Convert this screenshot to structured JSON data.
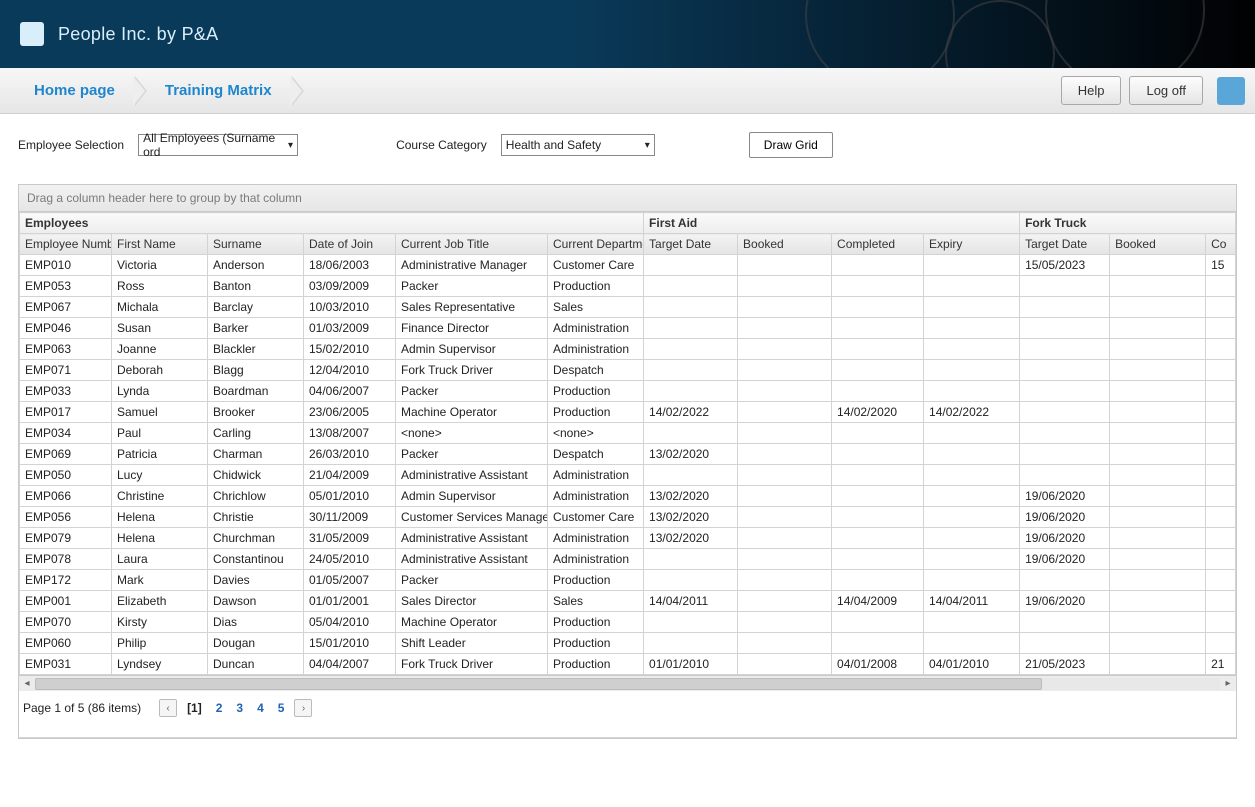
{
  "header": {
    "title": "People Inc. by P&A"
  },
  "breadcrumb": {
    "home": "Home page",
    "current": "Training Matrix"
  },
  "toolbar": {
    "help": "Help",
    "logoff": "Log off"
  },
  "filters": {
    "emp_label": "Employee Selection",
    "emp_value": "All Employees (Surname ord",
    "course_label": "Course Category",
    "course_value": "Health and Safety",
    "draw": "Draw Grid"
  },
  "grid": {
    "group_hint": "Drag a column header here to group by that column",
    "groups": {
      "emp": "Employees",
      "fa": "First Aid",
      "ft": "Fork Truck"
    },
    "cols": {
      "emp_no": "Employee Number",
      "first": "First Name",
      "surname": "Surname",
      "doj": "Date of Join",
      "title": "Current Job Title",
      "dept": "Current Departmen",
      "fa_target": "Target Date",
      "fa_booked": "Booked",
      "fa_comp": "Completed",
      "fa_exp": "Expiry",
      "ft_target": "Target Date",
      "ft_booked": "Booked",
      "ft_co": "Co"
    },
    "rows": [
      {
        "no": "EMP010",
        "first": "Victoria",
        "sur": "Anderson",
        "doj": "18/06/2003",
        "title": "Administrative Manager",
        "dept": "Customer Care",
        "fa_t": "",
        "fa_b": "",
        "fa_c": "",
        "fa_e": "",
        "ft_t": "15/05/2023",
        "ft_b": "",
        "ft_co": "15"
      },
      {
        "no": "EMP053",
        "first": "Ross",
        "sur": "Banton",
        "doj": "03/09/2009",
        "title": "Packer",
        "dept": "Production",
        "fa_t": "",
        "fa_b": "",
        "fa_c": "",
        "fa_e": "",
        "ft_t": "",
        "ft_b": "",
        "ft_co": ""
      },
      {
        "no": "EMP067",
        "first": "Michala",
        "sur": "Barclay",
        "doj": "10/03/2010",
        "title": "Sales Representative",
        "dept": "Sales",
        "fa_t": "",
        "fa_b": "",
        "fa_c": "",
        "fa_e": "",
        "ft_t": "",
        "ft_b": "",
        "ft_co": ""
      },
      {
        "no": "EMP046",
        "first": "Susan",
        "sur": "Barker",
        "doj": "01/03/2009",
        "title": "Finance Director",
        "dept": "Administration",
        "fa_t": "",
        "fa_b": "",
        "fa_c": "",
        "fa_e": "",
        "ft_t": "",
        "ft_b": "",
        "ft_co": ""
      },
      {
        "no": "EMP063",
        "first": "Joanne",
        "sur": "Blackler",
        "doj": "15/02/2010",
        "title": "Admin Supervisor",
        "dept": "Administration",
        "fa_t": "",
        "fa_b": "",
        "fa_c": "",
        "fa_e": "",
        "ft_t": "",
        "ft_b": "",
        "ft_co": ""
      },
      {
        "no": "EMP071",
        "first": "Deborah",
        "sur": "Blagg",
        "doj": "12/04/2010",
        "title": "Fork Truck Driver",
        "dept": "Despatch",
        "fa_t": "",
        "fa_b": "",
        "fa_c": "",
        "fa_e": "",
        "ft_t": "",
        "ft_b": "",
        "ft_co": ""
      },
      {
        "no": "EMP033",
        "first": "Lynda",
        "sur": "Boardman",
        "doj": "04/06/2007",
        "title": "Packer",
        "dept": "Production",
        "fa_t": "",
        "fa_b": "",
        "fa_c": "",
        "fa_e": "",
        "ft_t": "",
        "ft_b": "",
        "ft_co": ""
      },
      {
        "no": "EMP017",
        "first": "Samuel",
        "sur": "Brooker",
        "doj": "23/06/2005",
        "title": "Machine Operator",
        "dept": "Production",
        "fa_t": "14/02/2022",
        "fa_b": "",
        "fa_c": "14/02/2020",
        "fa_e": "14/02/2022",
        "ft_t": "",
        "ft_b": "",
        "ft_co": ""
      },
      {
        "no": "EMP034",
        "first": "Paul",
        "sur": "Carling",
        "doj": "13/08/2007",
        "title": "<none>",
        "dept": "<none>",
        "fa_t": "",
        "fa_b": "",
        "fa_c": "",
        "fa_e": "",
        "ft_t": "",
        "ft_b": "",
        "ft_co": ""
      },
      {
        "no": "EMP069",
        "first": "Patricia",
        "sur": "Charman",
        "doj": "26/03/2010",
        "title": "Packer",
        "dept": "Despatch",
        "fa_t": "13/02/2020",
        "fa_b": "",
        "fa_c": "",
        "fa_e": "",
        "ft_t": "",
        "ft_b": "",
        "ft_co": ""
      },
      {
        "no": "EMP050",
        "first": "Lucy",
        "sur": "Chidwick",
        "doj": "21/04/2009",
        "title": "Administrative Assistant",
        "dept": "Administration",
        "fa_t": "",
        "fa_b": "",
        "fa_c": "",
        "fa_e": "",
        "ft_t": "",
        "ft_b": "",
        "ft_co": ""
      },
      {
        "no": "EMP066",
        "first": "Christine",
        "sur": "Chrichlow",
        "doj": "05/01/2010",
        "title": "Admin Supervisor",
        "dept": "Administration",
        "fa_t": "13/02/2020",
        "fa_b": "",
        "fa_c": "",
        "fa_e": "",
        "ft_t": "19/06/2020",
        "ft_b": "",
        "ft_co": ""
      },
      {
        "no": "EMP056",
        "first": "Helena",
        "sur": "Christie",
        "doj": "30/11/2009",
        "title": "Customer Services Manager",
        "dept": "Customer Care",
        "fa_t": "13/02/2020",
        "fa_b": "",
        "fa_c": "",
        "fa_e": "",
        "ft_t": "19/06/2020",
        "ft_b": "",
        "ft_co": ""
      },
      {
        "no": "EMP079",
        "first": "Helena",
        "sur": "Churchman",
        "doj": "31/05/2009",
        "title": "Administrative Assistant",
        "dept": "Administration",
        "fa_t": "13/02/2020",
        "fa_b": "",
        "fa_c": "",
        "fa_e": "",
        "ft_t": "19/06/2020",
        "ft_b": "",
        "ft_co": ""
      },
      {
        "no": "EMP078",
        "first": "Laura",
        "sur": "Constantinou",
        "doj": "24/05/2010",
        "title": "Administrative Assistant",
        "dept": "Administration",
        "fa_t": "",
        "fa_b": "",
        "fa_c": "",
        "fa_e": "",
        "ft_t": "19/06/2020",
        "ft_b": "",
        "ft_co": ""
      },
      {
        "no": "EMP172",
        "first": "Mark",
        "sur": "Davies",
        "doj": "01/05/2007",
        "title": "Packer",
        "dept": "Production",
        "fa_t": "",
        "fa_b": "",
        "fa_c": "",
        "fa_e": "",
        "ft_t": "",
        "ft_b": "",
        "ft_co": ""
      },
      {
        "no": "EMP001",
        "first": "Elizabeth",
        "sur": "Dawson",
        "doj": "01/01/2001",
        "title": "Sales Director",
        "dept": "Sales",
        "fa_t": "14/04/2011",
        "fa_b": "",
        "fa_c": "14/04/2009",
        "fa_e": "14/04/2011",
        "ft_t": "19/06/2020",
        "ft_b": "",
        "ft_co": ""
      },
      {
        "no": "EMP070",
        "first": "Kirsty",
        "sur": "Dias",
        "doj": "05/04/2010",
        "title": "Machine Operator",
        "dept": "Production",
        "fa_t": "",
        "fa_b": "",
        "fa_c": "",
        "fa_e": "",
        "ft_t": "",
        "ft_b": "",
        "ft_co": ""
      },
      {
        "no": "EMP060",
        "first": "Philip",
        "sur": "Dougan",
        "doj": "15/01/2010",
        "title": "Shift Leader",
        "dept": "Production",
        "fa_t": "",
        "fa_b": "",
        "fa_c": "",
        "fa_e": "",
        "ft_t": "",
        "ft_b": "",
        "ft_co": ""
      },
      {
        "no": "EMP031",
        "first": "Lyndsey",
        "sur": "Duncan",
        "doj": "04/04/2007",
        "title": "Fork Truck Driver",
        "dept": "Production",
        "fa_t": "01/01/2010",
        "fa_b": "",
        "fa_c": "04/01/2008",
        "fa_e": "04/01/2010",
        "ft_t": "21/05/2023",
        "ft_b": "",
        "ft_co": "21"
      }
    ]
  },
  "pager": {
    "status": "Page 1 of 5 (86 items)",
    "pages": [
      "[1]",
      "2",
      "3",
      "4",
      "5"
    ]
  }
}
